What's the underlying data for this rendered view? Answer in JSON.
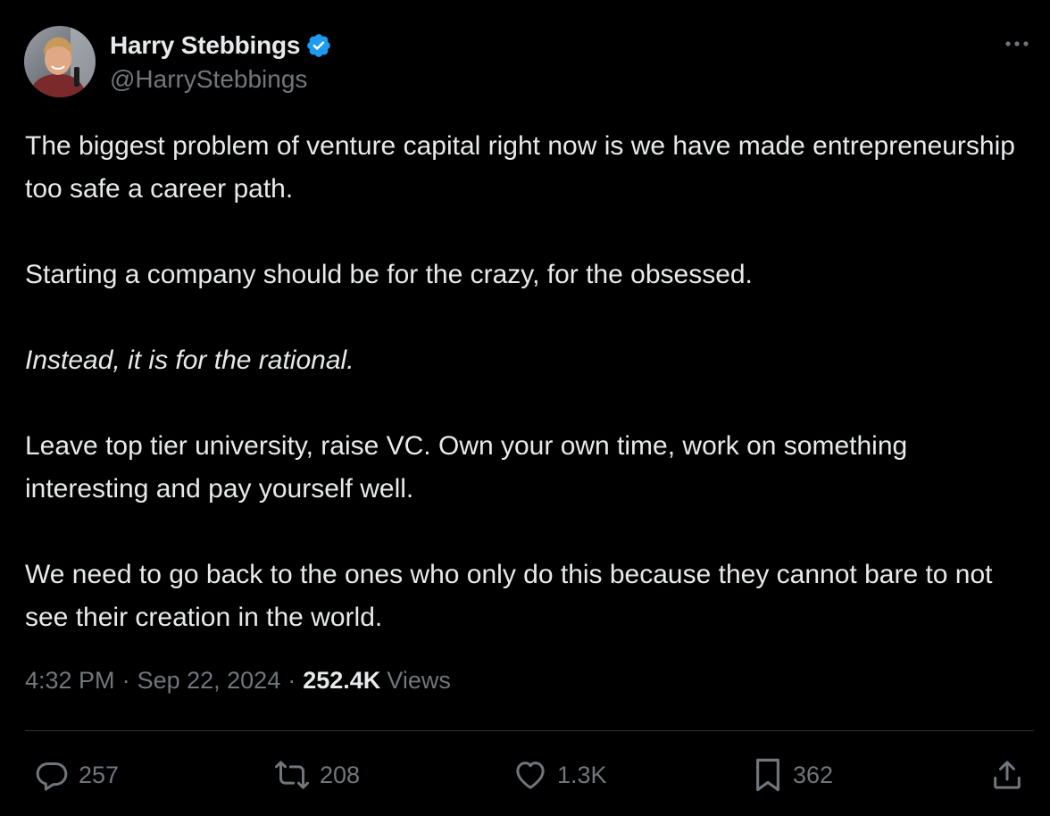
{
  "author": {
    "display_name": "Harry Stebbings",
    "handle": "@HarryStebbings",
    "verified": true,
    "avatar_icon": "avatar-photo"
  },
  "menu": {
    "icon": "more-dots-icon"
  },
  "post": {
    "paragraphs": [
      "The biggest problem of venture capital right now is we have made entrepreneurship too safe a career path.",
      "Starting a company should be for the crazy, for the obsessed.",
      "Instead, it is for the rational.",
      "Leave top tier university, raise VC. Own your own time, work on something interesting and pay yourself well.",
      "We need to go back to the ones who only do this because they cannot bare to not see their creation in the world."
    ]
  },
  "meta": {
    "time": "4:32 PM",
    "separator": "·",
    "date": "Sep 22, 2024",
    "views_count": "252.4K",
    "views_label": "Views"
  },
  "actions": {
    "replies": "257",
    "reposts": "208",
    "likes": "1.3K",
    "bookmarks": "362"
  },
  "colors": {
    "background": "#000000",
    "text_primary": "#e7e9ea",
    "text_secondary": "#71767b",
    "divider": "#2f3336",
    "verified_blue": "#1d9bf0"
  }
}
